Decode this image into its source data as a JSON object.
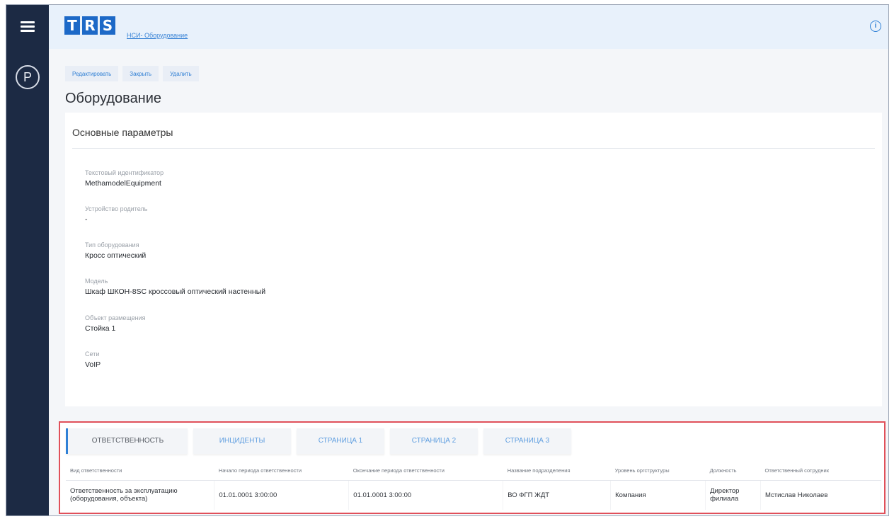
{
  "header": {
    "logo_letters": [
      "T",
      "R",
      "S"
    ],
    "breadcrumb": "НСИ- Оборудование",
    "user_initial": "P"
  },
  "actions": {
    "edit": "Редактировать",
    "close": "Закрыть",
    "delete": "Удалить"
  },
  "page_title": "Оборудование",
  "params": {
    "title": "Основные параметры",
    "fields": [
      {
        "label": "Текстовый идентификатор",
        "value": "MethamodelEquipment"
      },
      {
        "label": "Устройство родитель",
        "value": "-"
      },
      {
        "label": "Тип оборудования",
        "value": "Кросс оптический"
      },
      {
        "label": "Модель",
        "value": "Шкаф ШКОН-8SC кроссовый оптический настенный"
      },
      {
        "label": "Объект размещения",
        "value": "Стойка 1"
      },
      {
        "label": "Сети",
        "value": "VoIP"
      }
    ]
  },
  "tabs": [
    "ОТВЕТСТВЕННОСТЬ",
    "ИНЦИДЕНТЫ",
    "СТРАНИЦА 1",
    "СТРАНИЦА 2",
    "СТРАНИЦА 3"
  ],
  "table": {
    "columns": [
      "Вид ответственности",
      "Начало периода ответственности",
      "Окончание периода ответственности",
      "Название подразделения",
      "Уровень оргструктуры",
      "Должность",
      "Ответственный сотрудник"
    ],
    "rows": [
      [
        "Ответственность за эксплуатацию (оборудования, объекта)",
        "01.01.0001 3:00:00",
        "01.01.0001 3:00:00",
        "ВО ФГП ЖДТ",
        "Компания",
        "Директор филиала",
        "Мстислав Николаев"
      ]
    ]
  },
  "colors": {
    "sidebar": "#1c2a44",
    "accent": "#1d69c7",
    "highlight_border": "#e0505a"
  }
}
